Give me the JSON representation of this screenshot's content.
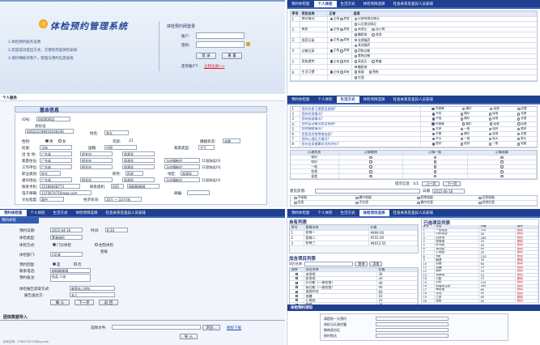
{
  "tabs": [
    "预约体检套",
    "个人体检",
    "生活方式",
    "体检项目选择",
    "社会关系及查异人员安排"
  ],
  "login": {
    "system_title": "体检预约管理系统",
    "tips": [
      "1.体检预约服务说明",
      "2.您是成功提出方式，方便您完成体检安排",
      "3.请仔细核对客户，管理与预约信息安排"
    ],
    "box_title": "体检预约网登录",
    "account_label": "账户:",
    "password_label": "密码:",
    "login_btn": "登 录",
    "reset_btn": "重 置",
    "no_account": "还有账户?",
    "register_link": "立即注册>>"
  },
  "grid": {
    "headers": [
      "序号",
      "项目名称",
      "正常",
      "选项"
    ],
    "rows": [
      {
        "n": "1",
        "name": "就诊情况",
        "opts": [
          "正常",
          "异常"
        ],
        "detail": [
          "以前有就诊情况",
          "以后就诊情况"
        ]
      },
      {
        "n": "2",
        "name": "病史",
        "opts": [
          "正常",
          "异常"
        ],
        "detail": [
          "高血压",
          "糖尿病",
          "冠心病",
          "其他"
        ]
      },
      {
        "n": "3",
        "name": "用药记录",
        "opts": [
          "正常",
          "异常"
        ],
        "detail": [
          "长期服药",
          "其他服药"
        ]
      },
      {
        "n": "4",
        "name": "过敏记录",
        "opts": [
          "正常",
          "异常"
        ],
        "detail": [
          "药物过敏",
          "食物过敏"
        ]
      },
      {
        "n": "5",
        "name": "家族遗传",
        "opts": [
          "正常",
          "异常"
        ],
        "detail": [
          "高血压",
          "糖尿病",
          "肿瘤"
        ]
      },
      {
        "n": "6",
        "name": "生活习惯",
        "opts": [
          "正常",
          "异常"
        ],
        "detail": [
          "吸烟",
          "饮酒",
          "熬夜"
        ]
      }
    ]
  },
  "basic": {
    "strip_label": "个人服务",
    "title": "基本信息",
    "id_label": "ID号:",
    "id_value": "00000002",
    "doc_type_label": "身份证",
    "id_card": "440222198410036336",
    "name_label": "姓名:",
    "name_value": "李丰",
    "gender_label": "性别:",
    "male": "男",
    "female": "女",
    "age_label": "年龄:",
    "age_value": "21",
    "marital_label": "婚姻状况:",
    "marital_value": "未婚",
    "ethnic_label": "民族:",
    "ethnic_value": "汉族",
    "nation_label": "国籍:",
    "nation_value": "中国",
    "family_label": "家庭类型:",
    "family_value": "主干",
    "addr_rows": [
      {
        "label": "出 生 地:",
        "prov": "广东省",
        "city": "韶关市",
        "dist": "翁源县",
        "detail": ""
      },
      {
        "label": "家庭住址:",
        "prov": "广东省",
        "city": "韶关市",
        "dist": "翁源县",
        "detail": "马市镇新村",
        "extra": "11国角组2号"
      },
      {
        "label": "工作单位:",
        "prov": "广东省",
        "city": "韶关市",
        "dist": "翁源县",
        "detail": "马市镇新村",
        "extra": "11国角组2号"
      }
    ],
    "job_label": "职业类别:",
    "job_value": "农业",
    "edu_label": "文化程度:",
    "edu_value": "高中",
    "post_label": "职务:",
    "post_value": "低收",
    "area_label": "地区:",
    "area_value": "翁源县",
    "comm_label": "通讯地址:",
    "comm_value": "广东省",
    "comm_city": "韶关市",
    "comm_dist": "翁源县",
    "comm_detail": "马市镇新村",
    "comm_extra": "11国角组2号",
    "phone_label": "联系手机:",
    "phone_value": "15168008773",
    "tel_label": "联系座机:",
    "tel_area": "020",
    "tel_num": "88888888",
    "email_label": "电子邮箱:",
    "email_value": "1375674719@qq.com",
    "postal_label": "邮编:",
    "income_label": "经济状况:",
    "income_value": "10万 — 10万/年"
  },
  "habits": {
    "items": [
      {
        "n": "1",
        "q": "您的饮食习惯是否规律?",
        "opts": [
          "不规律",
          "偶尔",
          "经常",
          "总是"
        ]
      },
      {
        "n": "2",
        "q": "您的饮酒情况?",
        "opts": [
          "不饮",
          "偶尔",
          "经常",
          "总是"
        ]
      },
      {
        "n": "3",
        "q": "您的吸烟情况?",
        "opts": [
          "不吸",
          "偶尔",
          "经常",
          "总是"
        ]
      },
      {
        "n": "4",
        "q": "您的运动情况是否规律?",
        "opts": [
          "不规律",
          "偶尔",
          "经常",
          "总是"
        ]
      },
      {
        "n": "5",
        "q": "您的睡眠情况?",
        "opts": [
          "不好",
          "一般",
          "较好",
          "很好"
        ]
      },
      {
        "n": "6",
        "q": "您是否经常熬夜加班?",
        "opts": [
          "不是",
          "偶尔",
          "经常",
          "总是"
        ]
      },
      {
        "n": "7",
        "q": "您的心理压力情况?",
        "opts": [
          "不大",
          "一般",
          "较大",
          "很大"
        ]
      },
      {
        "n": "8",
        "q": "您对自身健康状况的评价?",
        "opts": [
          "很好",
          "较好",
          "一般",
          "较差"
        ]
      }
    ],
    "table_headers": [
      "心理状态",
      "心情愉快",
      "心情一般",
      "心情烦躁"
    ],
    "table_rows": [
      "很好",
      "较好",
      "一般",
      "较差",
      "很差"
    ],
    "nav_label": "提示信息",
    "nav_page": "1/1",
    "prev_btn": "上一页",
    "next_btn": "下一页",
    "footer_label": "意见反馈:",
    "date_label": "日期",
    "date_value": "2015-06-16",
    "bottom_items": [
      "不吸烟",
      "偶尔吸烟",
      "经常吸烟",
      "总是吸烟",
      "饮酒",
      "不饮酒",
      "偶尔饮酒",
      "经常饮酒"
    ]
  },
  "booking": {
    "title": "预约体检",
    "date_label": "预约日期:",
    "date_value": "2015-04-16",
    "time_label": "时间:",
    "time_value": "8:30",
    "type_label": "体检类型:",
    "type_value": "套餐体检",
    "mode_label": "体检方式:",
    "mode_opts": [
      "门诊体检",
      "住院体检"
    ],
    "dept_label": "体检部门:",
    "dept_value": "C区域",
    "level_label": "星级",
    "reply_label": "预约回复:",
    "reply_opts": [
      "是",
      "否"
    ],
    "phone_label": "联系电话:",
    "phone_value": "88888888",
    "remark_label": "预约备注:",
    "remark_value": "低盐 少油",
    "method_label": "体检报告获取方式:",
    "method_value": "邮寄本人地址",
    "org_label": "报告送达方:",
    "org_value": "本人",
    "btns": [
      "确 认",
      "下一步",
      "返 回"
    ],
    "group_title": "团体数据导入",
    "file_label": "选择文件:",
    "browse": "浏览...",
    "upload_link": "模板下载",
    "import_btn": "导 入",
    "footer": "技术支持：4780578719@qq.com"
  },
  "packages": {
    "selected_title": "自有列表",
    "sel_headers": [
      "序号",
      "套餐名称",
      "价格"
    ],
    "sel_rows": [
      [
        "1",
        "套餐一",
        "¥999.00"
      ],
      [
        "2",
        "套餐二",
        "¥555.00"
      ],
      [
        "3",
        "套餐三",
        "¥8013.50"
      ]
    ],
    "add_title": "加含项目列表",
    "search_label": "项目名称:",
    "search_btn": "查询",
    "add_btn": "添加",
    "add_headers": [
      "选择",
      "项目名称",
      "价格"
    ],
    "add_rows": [
      [
        "血常规",
        "30"
      ],
      [
        "尿常规",
        "20"
      ],
      [
        "肝功能（一般检查）",
        "40"
      ],
      [
        "肾功能（一般检查）",
        "40"
      ],
      [
        "血脂四项",
        "60"
      ],
      [
        "血糖",
        "10"
      ],
      [
        "心电图",
        "25"
      ],
      [
        "胸透",
        "35"
      ]
    ],
    "list_title": "已选项目列表",
    "list_headers": [
      "序号",
      "项目",
      "价格",
      "操作"
    ],
    "list_rows": [
      [
        "1",
        "一般检查",
        "100",
        "删除"
      ],
      [
        "2",
        "内科检查",
        "40",
        "删除"
      ],
      [
        "3",
        "血常规",
        "180",
        "删除"
      ],
      [
        "4",
        "尿常规",
        "20",
        "删除"
      ],
      [
        "5",
        "肝功能",
        "40",
        "删除"
      ],
      [
        "6",
        "肾功能",
        "40",
        "删除"
      ],
      [
        "7",
        "心电图",
        "25",
        "删除"
      ],
      [
        "8",
        "B超",
        "120",
        "删除"
      ],
      [
        "9",
        "胸透",
        "35",
        "删除"
      ],
      [
        "10",
        "血脂",
        "60",
        "删除"
      ],
      [
        "11",
        "血糖",
        "10",
        "删除"
      ],
      [
        "12",
        "眼科",
        "15",
        "删除"
      ],
      [
        "13",
        "耳鼻喉",
        "15",
        "删除"
      ],
      [
        "14",
        "口腔",
        "15",
        "删除"
      ],
      [
        "15",
        "妇科",
        "120",
        "删除"
      ],
      [
        "16",
        "肿瘤标志物",
        "260",
        "删除"
      ],
      [
        "17",
        "骨密度",
        "80",
        "删除"
      ],
      [
        "18",
        "甲功",
        "95",
        "删除"
      ],
      [
        "19",
        "乙肝",
        "60",
        "删除"
      ],
      [
        "20",
        "颈椎",
        "45",
        "删除"
      ]
    ],
    "footer_title": "体检预约须知",
    "footer_lines": [
      "请提前一天预约",
      "体检当天请空腹",
      "携带身份证",
      "按时到达"
    ]
  }
}
